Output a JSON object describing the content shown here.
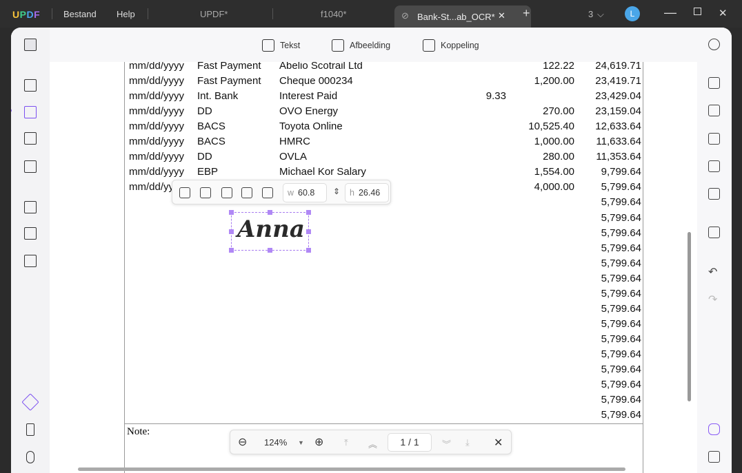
{
  "titlebar": {
    "logo": "UPDF",
    "menu": [
      "Bestand",
      "Help"
    ],
    "tabs": [
      "UPDF*",
      "f1040*",
      "Bank-St...ab_OCR*"
    ],
    "window_count": "3",
    "avatar": "L"
  },
  "toolbar": {
    "text": "Tekst",
    "image": "Afbeelding",
    "link": "Koppeling"
  },
  "rows": [
    [
      "mm/dd/yyyy",
      "Fast Payment",
      "Abelio Scotrail Ltd",
      "",
      "122.22",
      "24,619.71"
    ],
    [
      "mm/dd/yyyy",
      "Fast Payment",
      "Cheque 000234",
      "",
      "1,200.00",
      "23,419.71"
    ],
    [
      "mm/dd/yyyy",
      "Int. Bank",
      "Interest Paid",
      "9.33",
      "",
      "23,429.04"
    ],
    [
      "mm/dd/yyyy",
      "DD",
      "OVO Energy",
      "",
      "270.00",
      "23,159.04"
    ],
    [
      "mm/dd/yyyy",
      "BACS",
      "Toyota Online",
      "",
      "10,525.40",
      "12,633.64"
    ],
    [
      "mm/dd/yyyy",
      "BACS",
      "HMRC",
      "",
      "1,000.00",
      "11,633.64"
    ],
    [
      "mm/dd/yyyy",
      "DD",
      "OVLA",
      "",
      "280.00",
      "11,353.64"
    ],
    [
      "mm/dd/yyyy",
      "EBP",
      "Michael Kor Salary",
      "",
      "1,554.00",
      "9,799.64"
    ],
    [
      "mm/dd/yyyy",
      "",
      "",
      "",
      "4,000.00",
      "5,799.64"
    ],
    [
      "",
      "",
      "",
      "",
      "",
      "5,799.64"
    ],
    [
      "",
      "",
      "",
      "",
      "",
      "5,799.64"
    ],
    [
      "",
      "",
      "",
      "",
      "",
      "5,799.64"
    ],
    [
      "",
      "",
      "",
      "",
      "",
      "5,799.64"
    ],
    [
      "",
      "",
      "",
      "",
      "",
      "5,799.64"
    ],
    [
      "",
      "",
      "",
      "",
      "",
      "5,799.64"
    ],
    [
      "",
      "",
      "",
      "",
      "",
      "5,799.64"
    ],
    [
      "",
      "",
      "",
      "",
      "",
      "5,799.64"
    ],
    [
      "",
      "",
      "",
      "",
      "",
      "5,799.64"
    ],
    [
      "",
      "",
      "",
      "",
      "",
      "5,799.64"
    ],
    [
      "",
      "",
      "",
      "",
      "",
      "5,799.64"
    ],
    [
      "",
      "",
      "",
      "",
      "",
      "5,799.64"
    ],
    [
      "",
      "",
      "",
      "",
      "",
      "5,799.64"
    ],
    [
      "",
      "",
      "",
      "",
      "",
      "5,799.64"
    ],
    [
      "",
      "",
      "",
      "",
      "",
      "5,799.64"
    ]
  ],
  "note": "Note:",
  "image_toolbar": {
    "w_label": "w",
    "w": "60.8",
    "h_label": "h",
    "h": "26.46"
  },
  "signature": "Anna",
  "zoom": {
    "level": "124%",
    "page": "1 / 1"
  }
}
